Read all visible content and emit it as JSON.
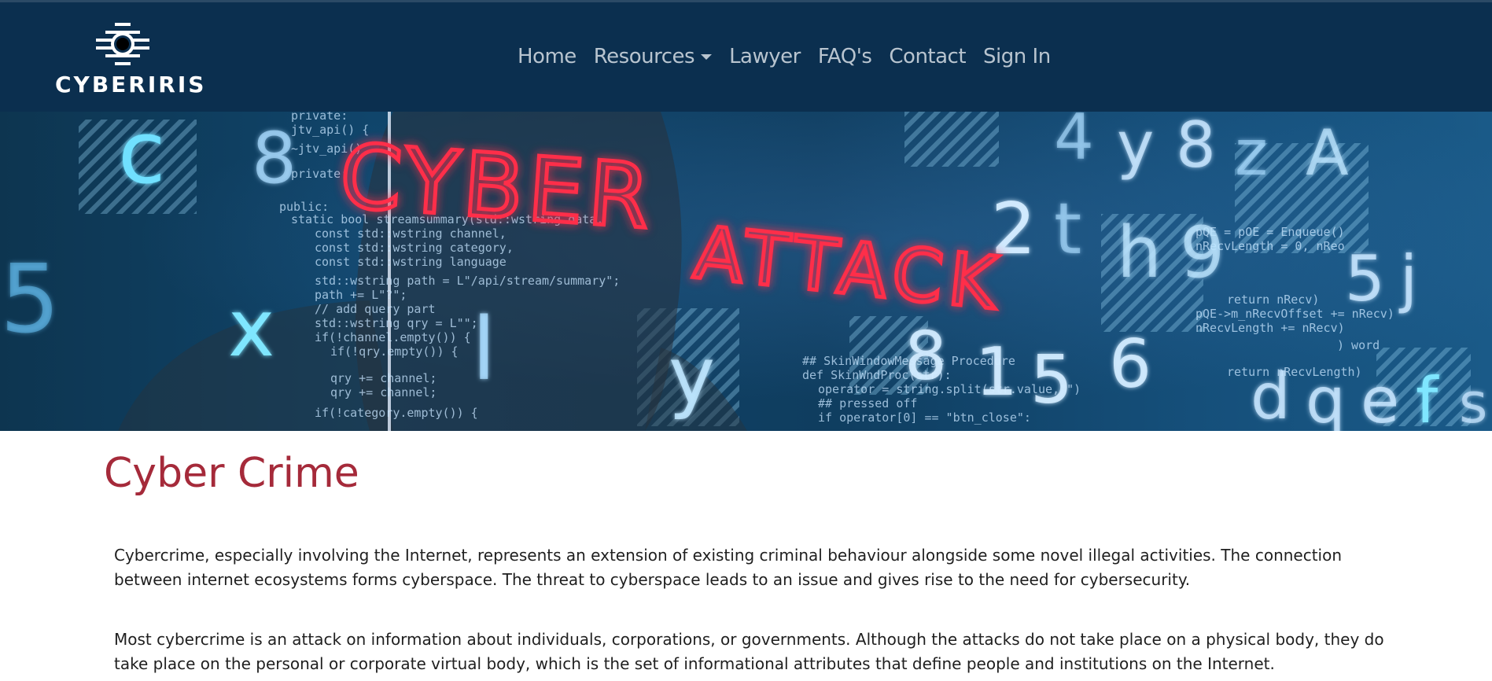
{
  "brand": {
    "name": "CYBERIRIS"
  },
  "nav": {
    "items": [
      {
        "label": "Home"
      },
      {
        "label": "Resources",
        "has_dropdown": true
      },
      {
        "label": "Lawyer"
      },
      {
        "label": "FAQ's"
      },
      {
        "label": "Contact"
      },
      {
        "label": "Sign In"
      }
    ]
  },
  "hero": {
    "headline_line1": "CYBER",
    "headline_line2": "ATTACK"
  },
  "main": {
    "title": "Cyber Crime",
    "paragraphs": [
      "Cybercrime, especially involving the Internet, represents an extension of existing criminal behaviour alongside some novel illegal activities. The connection between internet ecosystems forms cyberspace. The threat to cyberspace leads to an issue and gives rise to the need for cybersecurity.",
      "Most cybercrime is an attack on information about individuals, corporations, or governments. Although the attacks do not take place on a physical body, they do take place on the personal or corporate virtual body, which is the set of informational attributes that define people and institutions on the Internet."
    ]
  },
  "colors": {
    "navbar_bg": "#0b2f4f",
    "nav_link": "#b8c4cf",
    "title_accent": "#a52a3a",
    "neon_red": "#ff2d4a"
  },
  "icons": {
    "logo": "iris-eye-icon"
  }
}
